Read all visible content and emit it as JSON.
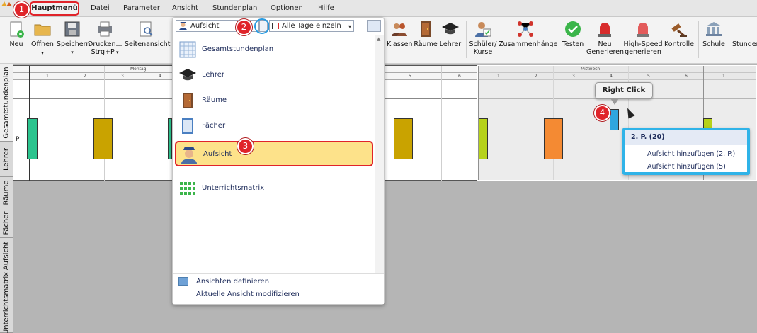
{
  "menubar": {
    "items": [
      "Hauptmenü",
      "Datei",
      "Parameter",
      "Ansicht",
      "Stundenplan",
      "Optionen",
      "Hilfe"
    ]
  },
  "ribbon": {
    "left_buttons": [
      "Neu",
      "Öffnen",
      "Speichern",
      "Drucken...",
      "Seitenansicht"
    ],
    "print_shortcut": "Strg+P",
    "right_buttons": [
      "Klassen",
      "Räume",
      "Lehrer",
      "Schüler/",
      "Kurse",
      "Zusammenhänge",
      "Testen",
      "Neu",
      "Generieren",
      "High-Speed",
      "generieren",
      "Kontrolle",
      "Schule",
      "Stunden"
    ]
  },
  "vertical_tabs": [
    "Gesamtstundenplan",
    "Lehrer",
    "Räume",
    "Fächer",
    "Aufsicht",
    "Unterrichtsmatrix"
  ],
  "grid": {
    "days": [
      "Montag",
      "Mittwoch"
    ],
    "slots_left": [
      "1",
      "2",
      "3",
      "4",
      "5",
      "6"
    ],
    "slots_right": [
      "1",
      "2",
      "3",
      "4",
      "5",
      "6",
      "1"
    ],
    "slots_mid": [
      "5",
      "6"
    ],
    "row_label": "P",
    "colors": {
      "teal": "#2bc48e",
      "gold": "#c9a300",
      "lime": "#b6d21a",
      "orange": "#f48a33",
      "blue": "#2fa6df"
    }
  },
  "dropdown": {
    "view_select": "Aufsicht",
    "days_select": "Alle Tage einzeln",
    "options": [
      "Gesamtstundenplan",
      "Lehrer",
      "Räume",
      "Fächer",
      "Aufsicht",
      "Unterrichtsmatrix"
    ],
    "selected": "Aufsicht",
    "footer": [
      "Ansichten definieren",
      "Aktuelle Ansicht modifizieren"
    ]
  },
  "annotations": {
    "badges": [
      "1",
      "2",
      "3",
      "4"
    ],
    "tooltip": "Right Click"
  },
  "context_menu": {
    "header": "2. P. (20)",
    "items": [
      "Aufsicht hinzufügen (2. P.)",
      "Aufsicht hinzufügen (5)"
    ]
  }
}
